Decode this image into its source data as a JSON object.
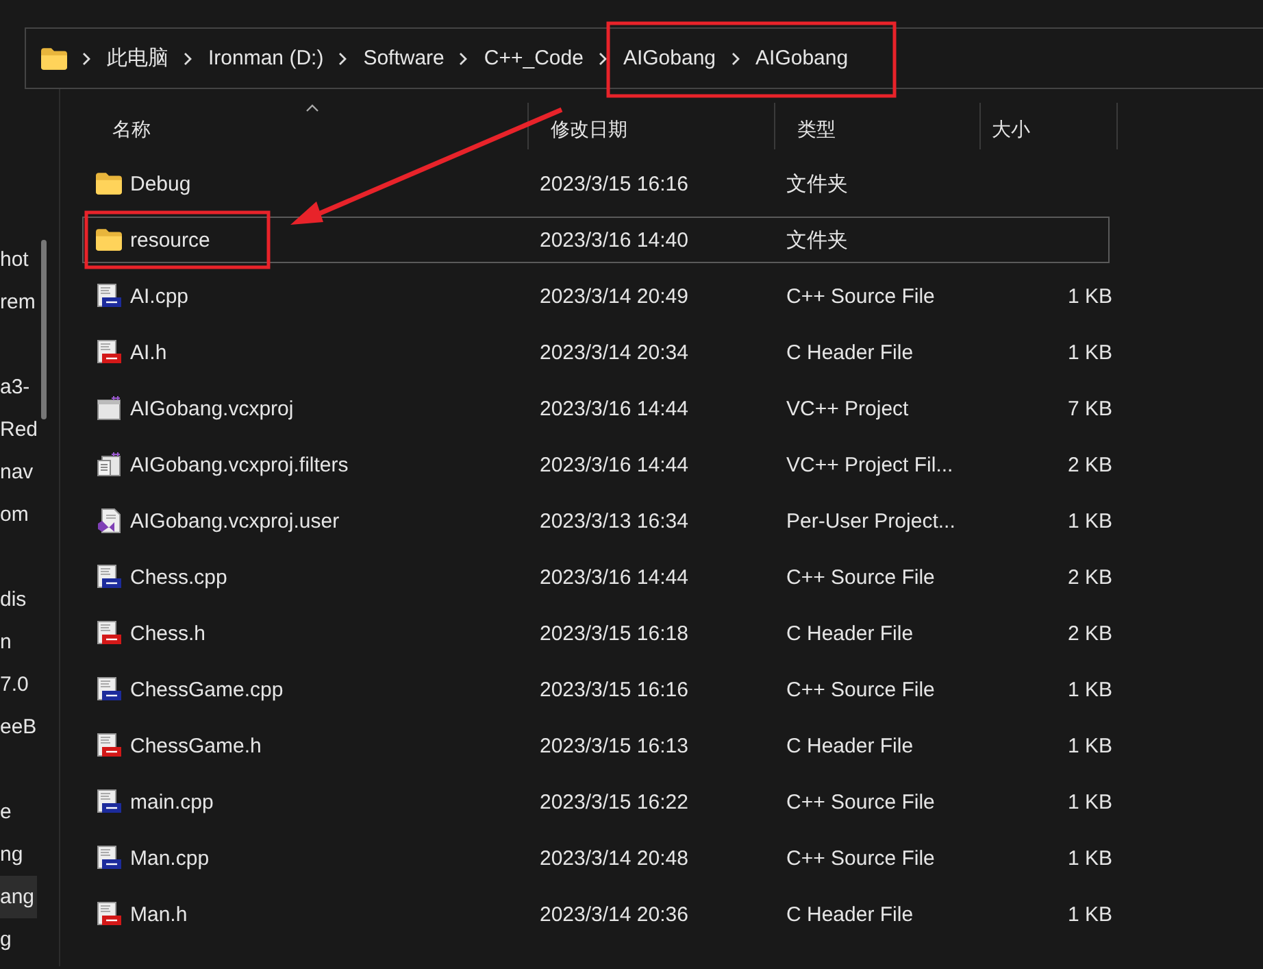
{
  "sidebar": {
    "groups": [
      [
        {
          "label": "hot",
          "selected": false
        },
        {
          "label": "rem",
          "selected": false
        }
      ],
      [
        {
          "label": "a3-",
          "selected": false
        },
        {
          "label": "Red",
          "selected": false
        },
        {
          "label": "nav",
          "selected": false
        },
        {
          "label": "om",
          "selected": false
        }
      ],
      [
        {
          "label": "dis",
          "selected": false
        },
        {
          "label": "n",
          "selected": false
        },
        {
          "label": "7.0",
          "selected": false
        },
        {
          "label": "eeB",
          "selected": false
        }
      ],
      [
        {
          "label": "e",
          "selected": false
        },
        {
          "label": "ng",
          "selected": false
        },
        {
          "label": "ang",
          "selected": true
        },
        {
          "label": "g",
          "selected": false
        }
      ]
    ]
  },
  "address_bar": {
    "crumbs": [
      "此电脑",
      "Ironman (D:)",
      "Software",
      "C++_Code",
      "AIGobang",
      "AIGobang"
    ]
  },
  "table": {
    "columns": [
      {
        "label": "名称",
        "sorted": true
      },
      {
        "label": "修改日期",
        "sorted": false
      },
      {
        "label": "类型",
        "sorted": false
      },
      {
        "label": "大小",
        "sorted": false
      }
    ],
    "rows": [
      {
        "kind": "folder",
        "name": "Debug",
        "date": "2023/3/15 16:16",
        "type": "文件夹",
        "focused": false
      },
      {
        "kind": "folder",
        "name": "resource",
        "date": "2023/3/16 14:40",
        "type": "文件夹",
        "focused": true
      },
      {
        "kind": "cpp",
        "name": "AI.cpp",
        "date": "2023/3/14 20:49",
        "type": "C++ Source File",
        "size": "1 KB",
        "focused": false
      },
      {
        "kind": "h",
        "name": "AI.h",
        "date": "2023/3/14 20:34",
        "type": "C Header File",
        "size": "1 KB",
        "focused": false
      },
      {
        "kind": "project",
        "name": "AIGobang.vcxproj",
        "date": "2023/3/16 14:44",
        "type": "VC++ Project",
        "size": "7 KB",
        "focused": false
      },
      {
        "kind": "filters",
        "name": "AIGobang.vcxproj.filters",
        "date": "2023/3/16 14:44",
        "type": "VC++ Project Fil...",
        "size": "2 KB",
        "focused": false
      },
      {
        "kind": "user",
        "name": "AIGobang.vcxproj.user",
        "date": "2023/3/13 16:34",
        "type": "Per-User Project...",
        "size": "1 KB",
        "focused": false
      },
      {
        "kind": "cpp",
        "name": "Chess.cpp",
        "date": "2023/3/16 14:44",
        "type": "C++ Source File",
        "size": "2 KB",
        "focused": false
      },
      {
        "kind": "h",
        "name": "Chess.h",
        "date": "2023/3/15 16:18",
        "type": "C Header File",
        "size": "2 KB",
        "focused": false
      },
      {
        "kind": "cpp",
        "name": "ChessGame.cpp",
        "date": "2023/3/15 16:16",
        "type": "C++ Source File",
        "size": "1 KB",
        "focused": false
      },
      {
        "kind": "h",
        "name": "ChessGame.h",
        "date": "2023/3/15 16:13",
        "type": "C Header File",
        "size": "1 KB",
        "focused": false
      },
      {
        "kind": "cpp",
        "name": "main.cpp",
        "date": "2023/3/15 16:22",
        "type": "C++ Source File",
        "size": "1 KB",
        "focused": false
      },
      {
        "kind": "cpp",
        "name": "Man.cpp",
        "date": "2023/3/14 20:48",
        "type": "C++ Source File",
        "size": "1 KB",
        "focused": false
      },
      {
        "kind": "h",
        "name": "Man.h",
        "date": "2023/3/14 20:36",
        "type": "C Header File",
        "size": "1 KB",
        "focused": false
      }
    ]
  }
}
